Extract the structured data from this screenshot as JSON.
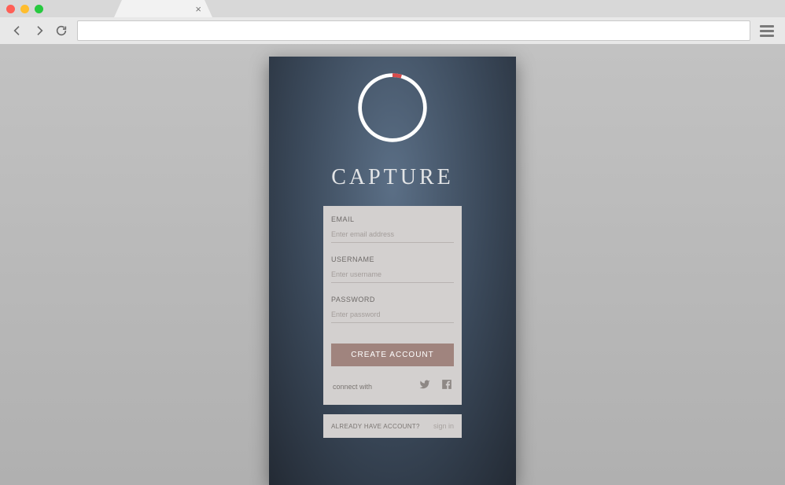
{
  "app": {
    "title": "CAPTURE"
  },
  "form": {
    "email_label": "EMAIL",
    "email_placeholder": "Enter email address",
    "username_label": "USERNAME",
    "username_placeholder": "Enter username",
    "password_label": "PASSWORD",
    "password_placeholder": "Enter password",
    "create_button": "CREATE ACCOUNT",
    "connect_label": "connect with"
  },
  "signin": {
    "already_label": "ALREADY HAVE ACCOUNT?",
    "signin_label": "sign in"
  }
}
